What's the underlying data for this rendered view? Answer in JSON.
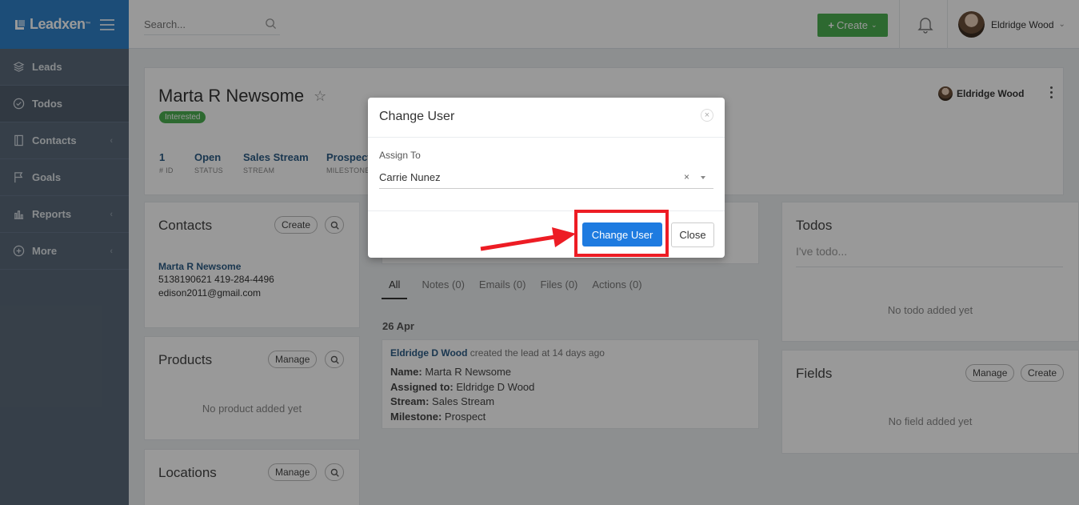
{
  "brand": {
    "name": "Leadxen",
    "tm": "™"
  },
  "sidebar": {
    "items": [
      {
        "label": "Leads",
        "icon": "layers-icon"
      },
      {
        "label": "Todos",
        "icon": "check-circle-icon"
      },
      {
        "label": "Contacts",
        "icon": "book-icon"
      },
      {
        "label": "Goals",
        "icon": "flag-icon"
      },
      {
        "label": "Reports",
        "icon": "bar-chart-icon"
      },
      {
        "label": "More",
        "icon": "plus-circle-icon"
      }
    ]
  },
  "topbar": {
    "search_placeholder": "Search...",
    "create_label": "Create",
    "user_name": "Eldridge Wood"
  },
  "lead": {
    "name": "Marta R Newsome",
    "status_badge": "Interested",
    "owner": "Eldridge Wood",
    "meta": [
      {
        "value": "1",
        "label": "# ID"
      },
      {
        "value": "Open",
        "label": "STATUS"
      },
      {
        "value": "Sales Stream",
        "label": "STREAM"
      },
      {
        "value": "Prospect",
        "label": "MILESTONE"
      }
    ]
  },
  "contacts": {
    "title": "Contacts",
    "create_label": "Create",
    "name": "Marta R Newsome",
    "phones": "5138190621 419-284-4496",
    "email": "edison2011@gmail.com"
  },
  "products": {
    "title": "Products",
    "manage_label": "Manage",
    "empty": "No product added yet"
  },
  "locations": {
    "title": "Locations",
    "manage_label": "Manage"
  },
  "timeline": {
    "tabs": [
      "All",
      "Notes (0)",
      "Emails (0)",
      "Files (0)",
      "Actions (0)"
    ],
    "date": "26 Apr",
    "activity": {
      "actor": "Eldridge D Wood",
      "action": "created the lead at 14 days ago",
      "lines": [
        {
          "k": "Name:",
          "v": "Marta R Newsome"
        },
        {
          "k": "Assigned to:",
          "v": "Eldridge D Wood"
        },
        {
          "k": "Stream:",
          "v": "Sales Stream"
        },
        {
          "k": "Milestone:",
          "v": "Prospect"
        }
      ]
    }
  },
  "todos": {
    "title": "Todos",
    "placeholder": "I've todo...",
    "empty": "No todo added yet"
  },
  "fields": {
    "title": "Fields",
    "manage_label": "Manage",
    "create_label": "Create",
    "empty": "No field added yet"
  },
  "modal": {
    "title": "Change User",
    "close_x": "×",
    "label": "Assign To",
    "selected": "Carrie Nunez",
    "clear": "×",
    "primary": "Change User",
    "secondary": "Close"
  },
  "colors": {
    "brand_blue": "#2f80c9",
    "sidebar": "#5b6a7a",
    "create_green": "#4caf50",
    "primary_blue": "#1e7be0",
    "highlight_red": "#ed1c24"
  }
}
